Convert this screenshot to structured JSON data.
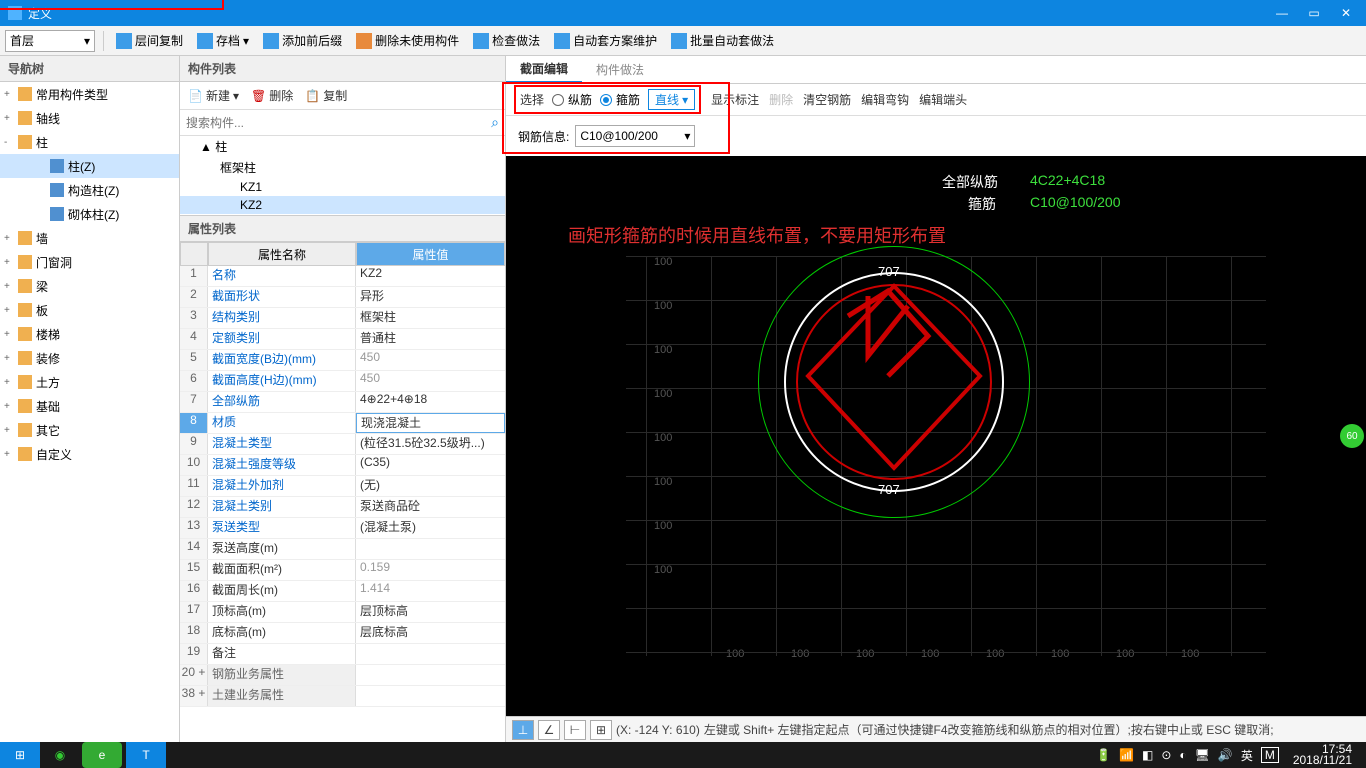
{
  "title": "定义",
  "floor_combo": "首层",
  "toolbar": {
    "copy_between": "层间复制",
    "archive": "存档",
    "add_suffix": "添加前后缀",
    "del_unused": "删除未使用构件",
    "check_method": "检查做法",
    "auto_plan": "自动套方案维护",
    "batch_auto": "批量自动套做法"
  },
  "nav": {
    "header": "导航树",
    "items": [
      {
        "label": "常用构件类型",
        "exp": "+"
      },
      {
        "label": "轴线",
        "exp": "+"
      },
      {
        "label": "柱",
        "exp": "-"
      },
      {
        "label": "柱(Z)",
        "indent": 2,
        "icon": "blue",
        "sel": true
      },
      {
        "label": "构造柱(Z)",
        "indent": 2,
        "icon": "blue"
      },
      {
        "label": "砌体柱(Z)",
        "indent": 2,
        "icon": "blue"
      },
      {
        "label": "墙",
        "exp": "+"
      },
      {
        "label": "门窗洞",
        "exp": "+"
      },
      {
        "label": "梁",
        "exp": "+"
      },
      {
        "label": "板",
        "exp": "+"
      },
      {
        "label": "楼梯",
        "exp": "+"
      },
      {
        "label": "装修",
        "exp": "+"
      },
      {
        "label": "土方",
        "exp": "+"
      },
      {
        "label": "基础",
        "exp": "+"
      },
      {
        "label": "其它",
        "exp": "+"
      },
      {
        "label": "自定义",
        "exp": "+"
      }
    ]
  },
  "comp_list": {
    "header": "构件列表",
    "new": "新建",
    "delete": "删除",
    "copy": "复制",
    "search_ph": "搜索构件...",
    "tree": [
      {
        "label": "▲ 柱"
      },
      {
        "label": "框架柱",
        "l": 2
      },
      {
        "label": "KZ1",
        "l": 3
      },
      {
        "label": "KZ2",
        "l": 3,
        "sel": true
      }
    ]
  },
  "prop": {
    "header": "属性列表",
    "col_name": "属性名称",
    "col_val": "属性值",
    "rows": [
      {
        "n": "1",
        "name": "名称",
        "val": "KZ2"
      },
      {
        "n": "2",
        "name": "截面形状",
        "val": "异形"
      },
      {
        "n": "3",
        "name": "结构类别",
        "val": "框架柱"
      },
      {
        "n": "4",
        "name": "定额类别",
        "val": "普通柱"
      },
      {
        "n": "5",
        "name": "截面宽度(B边)(mm)",
        "val": "450",
        "gray": true
      },
      {
        "n": "6",
        "name": "截面高度(H边)(mm)",
        "val": "450",
        "gray": true
      },
      {
        "n": "7",
        "name": "全部纵筋",
        "val": "4⊕22+4⊕18"
      },
      {
        "n": "8",
        "name": "材质",
        "val": "现浇混凝土",
        "sel": true
      },
      {
        "n": "9",
        "name": "混凝土类型",
        "val": "(粒径31.5砼32.5级坍...)"
      },
      {
        "n": "10",
        "name": "混凝土强度等级",
        "val": "(C35)"
      },
      {
        "n": "11",
        "name": "混凝土外加剂",
        "val": "(无)"
      },
      {
        "n": "12",
        "name": "混凝土类别",
        "val": "泵送商品砼"
      },
      {
        "n": "13",
        "name": "泵送类型",
        "val": "(混凝土泵)"
      },
      {
        "n": "14",
        "name": "泵送高度(m)",
        "val": "",
        "black": true
      },
      {
        "n": "15",
        "name": "截面面积(m²)",
        "val": "0.159",
        "gray": true,
        "black": true
      },
      {
        "n": "16",
        "name": "截面周长(m)",
        "val": "1.414",
        "gray": true,
        "black": true
      },
      {
        "n": "17",
        "name": "顶标高(m)",
        "val": "层顶标高",
        "black": true
      },
      {
        "n": "18",
        "name": "底标高(m)",
        "val": "层底标高",
        "black": true
      },
      {
        "n": "19",
        "name": "备注",
        "val": "",
        "black": true
      },
      {
        "n": "20 +",
        "name": "钢筋业务属性",
        "val": "",
        "group": true
      },
      {
        "n": "38 +",
        "name": "土建业务属性",
        "val": "",
        "group": true
      }
    ]
  },
  "section": {
    "tab1": "截面编辑",
    "tab2": "构件做法",
    "select": "选择",
    "long_bar": "纵筋",
    "stirrup": "箍筋",
    "line": "直线",
    "show_label": "显示标注",
    "delete": "删除",
    "clear": "清空钢筋",
    "edit_hook": "编辑弯钩",
    "edit_end": "编辑端头",
    "rebar_info": "钢筋信息:",
    "rebar_val": "C10@100/200",
    "annotation": "画矩形箍筋的时候用直线布置，不要用矩形布置",
    "label_all": "全部纵筋",
    "label_all_val": "4C22+4C18",
    "label_stirrup": "箍筋",
    "label_stirrup_val": "C10@100/200",
    "dim707a": "707",
    "dim707b": "707",
    "grid100": "100"
  },
  "status": {
    "coord": "(X: -124 Y: 610)",
    "hint": "左键或 Shift+ 左键指定起点（可通过快捷键F4改变箍筋线和纵筋点的相对位置）;按右键中止或 ESC 键取消;",
    "badge": "60"
  },
  "taskbar": {
    "time": "17:54",
    "date": "2018/11/21",
    "ime1": "英",
    "ime2": "M"
  }
}
